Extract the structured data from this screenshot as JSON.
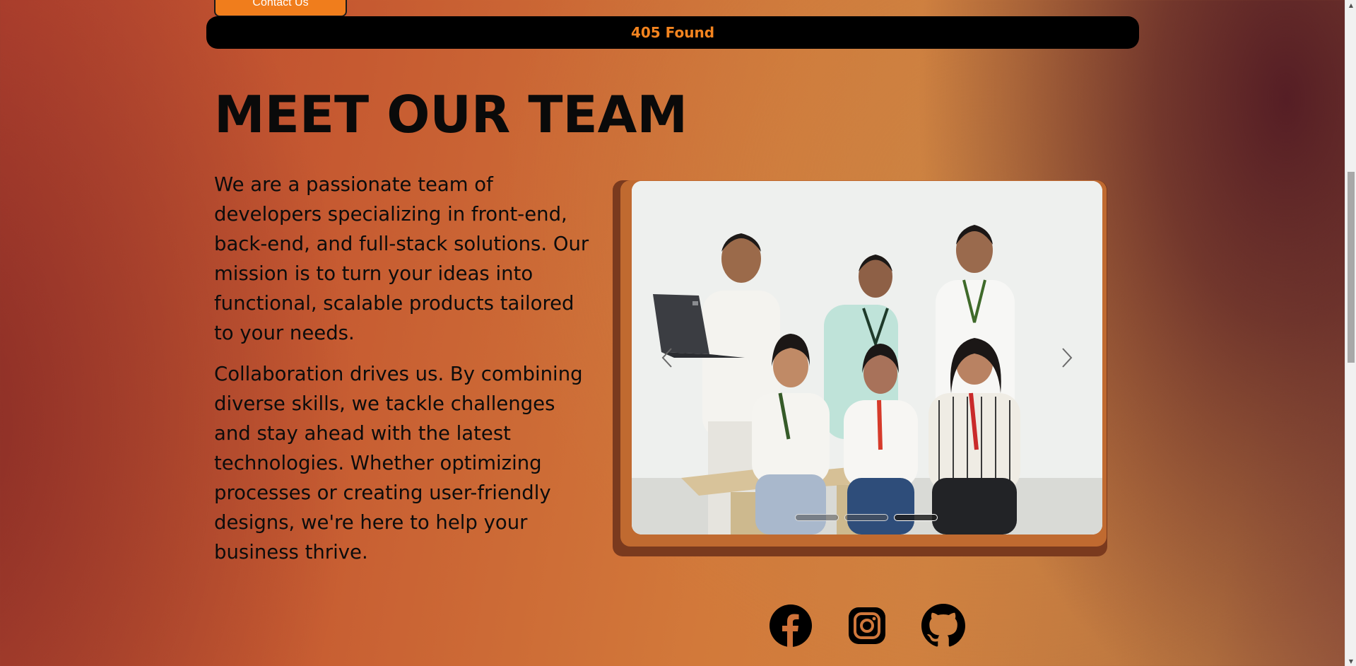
{
  "header": {
    "contact_label": "Contact Us"
  },
  "status": {
    "text": "405 Found",
    "color": "#f4841f"
  },
  "team": {
    "title": "MEET OUR TEAM",
    "paragraphs": [
      "We are a passionate team of developers specializing in front-end, back-end, and full-stack solutions. Our mission is to turn your ideas into functional, scalable products tailored to your needs.",
      "Collaboration drives us. By combining diverse skills, we tackle challenges and stay ahead with the latest technologies. Whether optimizing processes or creating user-friendly designs, we're here to help your business thrive."
    ]
  },
  "carousel": {
    "prev_icon": "chevron-left-icon",
    "next_icon": "chevron-right-icon",
    "slide_count": 3,
    "active_index": 2
  },
  "socials": [
    {
      "icon": "facebook-icon"
    },
    {
      "icon": "instagram-icon"
    },
    {
      "icon": "github-icon"
    }
  ],
  "colors": {
    "accent": "#f07d1c",
    "text": "#0a0a0a",
    "bar": "#000000"
  }
}
